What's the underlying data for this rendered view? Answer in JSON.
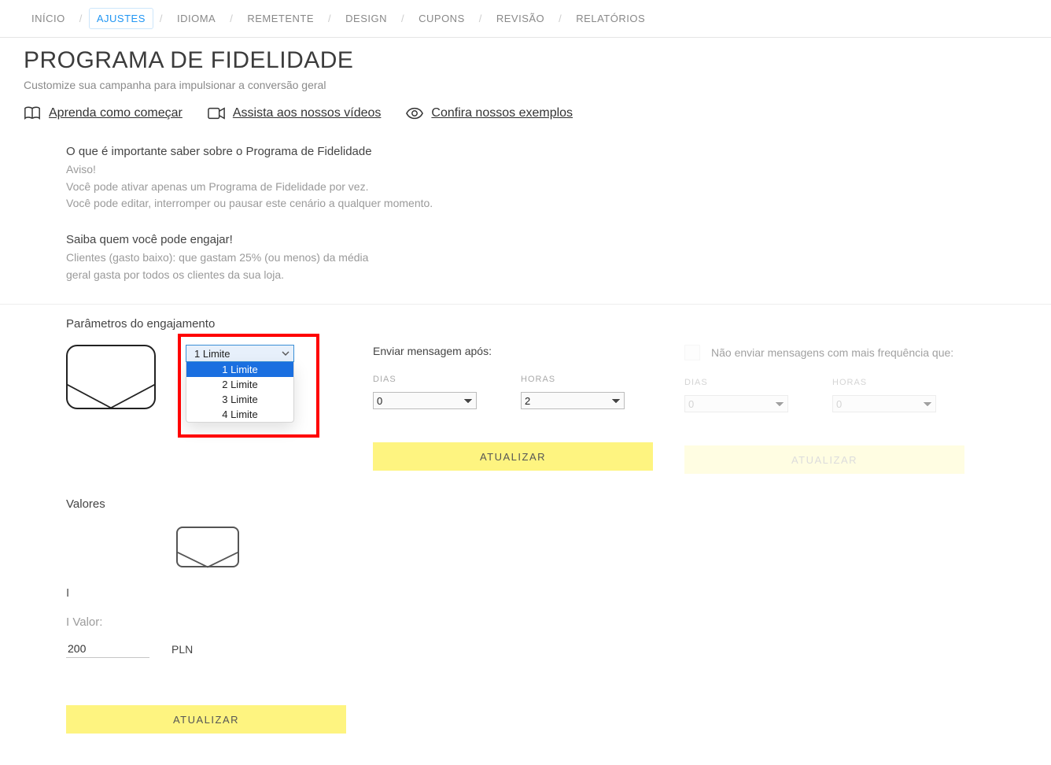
{
  "nav": {
    "items": [
      {
        "label": "INÍCIO",
        "active": false
      },
      {
        "label": "AJUSTES",
        "active": true
      },
      {
        "label": "IDIOMA",
        "active": false
      },
      {
        "label": "REMETENTE",
        "active": false
      },
      {
        "label": "DESIGN",
        "active": false
      },
      {
        "label": "CUPONS",
        "active": false
      },
      {
        "label": "REVISÃO",
        "active": false
      },
      {
        "label": "RELATÓRIOS",
        "active": false
      }
    ]
  },
  "page": {
    "title": "PROGRAMA DE FIDELIDADE",
    "subtitle": "Customize sua campanha para impulsionar a conversão geral"
  },
  "help": {
    "learn": "Aprenda como começar",
    "videos": "Assista aos nossos vídeos",
    "examples": "Confira nossos exemplos"
  },
  "info1": {
    "hdr": "O que é importante saber sobre o Programa de Fidelidade",
    "l1": "Aviso!",
    "l2": "Você pode ativar apenas um Programa de Fidelidade por vez.",
    "l3": "Você pode editar, interromper ou pausar este cenário a qualquer momento."
  },
  "info2": {
    "hdr": "Saiba quem você pode engajar!",
    "l1": "Clientes (gasto baixo): que gastam 25% (ou menos) da média",
    "l2": "geral gasta por todos os clientes da sua loja."
  },
  "params": {
    "title": "Parâmetros do engajamento",
    "limit_select_value": "1 Limite",
    "limit_options": [
      "1 Limite",
      "2 Limite",
      "3 Limite",
      "4 Limite"
    ],
    "send_after_label": "Enviar mensagem após:",
    "freq_label": "Não enviar mensagens com mais frequência que:",
    "days_label": "DIAS",
    "hours_label": "HORAS",
    "days1": "0",
    "hours1": "2",
    "days2": "0",
    "hours2": "0",
    "update_btn": "ATUALIZAR"
  },
  "valores": {
    "title": "Valores",
    "roman": "I",
    "valor_label": "I Valor:",
    "value": "200",
    "currency": "PLN",
    "update_btn": "ATUALIZAR"
  }
}
